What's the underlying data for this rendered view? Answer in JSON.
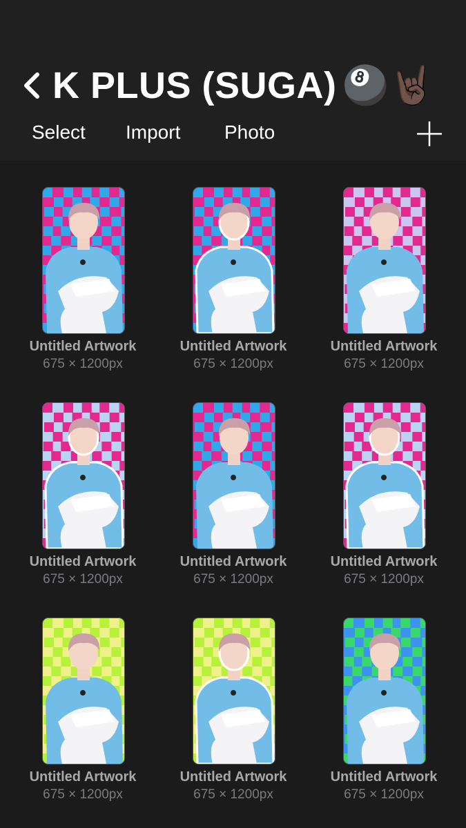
{
  "header": {
    "title": "K PLUS (SUGA)",
    "emoji": "🎱🤘🏿",
    "back_icon": "chevron-left-icon",
    "add_icon": "plus-icon"
  },
  "toolbar": {
    "select_label": "Select",
    "import_label": "Import",
    "photo_label": "Photo"
  },
  "colors": {
    "background": "#1b1b1c",
    "header": "#202021",
    "caption": "#a9a9ab",
    "dims": "#7c7c80",
    "hoodie": "#72bde8",
    "hair": "#c99fa8"
  },
  "artworks": [
    {
      "title": "Untitled Artwork",
      "size": "675 × 1200px",
      "bg1": "#2fa9ea",
      "bg2": "#e3298f",
      "outline": false
    },
    {
      "title": "Untitled Artwork",
      "size": "675 × 1200px",
      "bg1": "#2fa9ea",
      "bg2": "#e3298f",
      "outline": true
    },
    {
      "title": "Untitled Artwork",
      "size": "675 × 1200px",
      "bg1": "#e3298f",
      "bg2": "#c9c6f2",
      "outline": false
    },
    {
      "title": "Untitled Artwork",
      "size": "675 × 1200px",
      "bg1": "#e3298f",
      "bg2": "#b9d4f2",
      "outline": true
    },
    {
      "title": "Untitled Artwork",
      "size": "675 × 1200px",
      "bg1": "#2fa9ea",
      "bg2": "#e3298f",
      "outline": false
    },
    {
      "title": "Untitled Artwork",
      "size": "675 × 1200px",
      "bg1": "#e3298f",
      "bg2": "#b9d4f2",
      "outline": true
    },
    {
      "title": "Untitled Artwork",
      "size": "675 × 1200px",
      "bg1": "#b6f23a",
      "bg2": "#f0f08a",
      "outline": false
    },
    {
      "title": "Untitled Artwork",
      "size": "675 × 1200px",
      "bg1": "#b6f23a",
      "bg2": "#f0f08a",
      "outline": true
    },
    {
      "title": "Untitled Artwork",
      "size": "675 × 1200px",
      "bg1": "#38d86a",
      "bg2": "#3f93f0",
      "outline": false
    }
  ]
}
